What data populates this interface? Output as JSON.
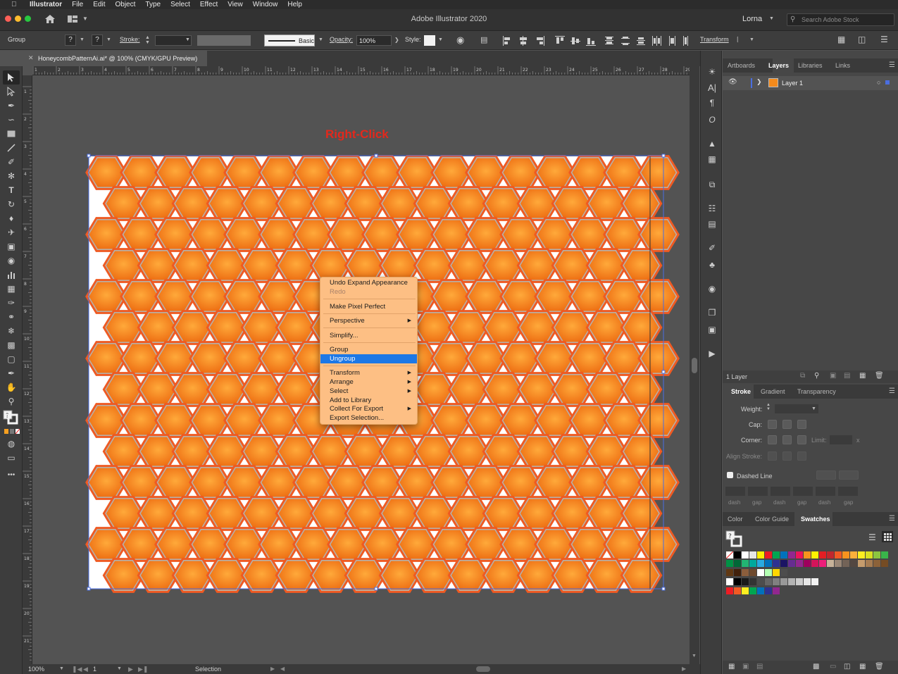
{
  "menubar": {
    "app_name": "Illustrator",
    "items": [
      "File",
      "Edit",
      "Object",
      "Type",
      "Select",
      "Effect",
      "View",
      "Window",
      "Help"
    ]
  },
  "appbar": {
    "title": "Adobe Illustrator 2020",
    "user": "Lorna",
    "search_placeholder": "Search Adobe Stock"
  },
  "control_bar": {
    "selection_type": "Group",
    "stroke_label": "Stroke:",
    "brush_name": "Basic",
    "opacity_label": "Opacity:",
    "opacity_value": "100%",
    "style_label": "Style:",
    "transform_label": "Transform"
  },
  "document": {
    "tab_title": "HoneycombPatternAi.ai* @ 100% (CMYK/GPU Preview)",
    "ruler_top_labels": [
      "1",
      "2",
      "3",
      "4",
      "5",
      "6",
      "7",
      "8",
      "9",
      "10",
      "11",
      "12",
      "13",
      "14",
      "15",
      "16",
      "17",
      "18",
      "19",
      "20",
      "21",
      "22",
      "23",
      "24",
      "25",
      "26",
      "27",
      "28",
      "29"
    ],
    "ruler_left_labels": [
      "1",
      "2",
      "3",
      "4",
      "5",
      "6",
      "7",
      "8",
      "9",
      "10",
      "11",
      "12",
      "13",
      "14",
      "15",
      "16",
      "17",
      "18",
      "19",
      "20",
      "21"
    ]
  },
  "annotation": "Right-Click",
  "context_menu": {
    "items": [
      {
        "label": "Undo Expand Appearance",
        "disabled": false,
        "submenu": false
      },
      {
        "label": "Redo",
        "disabled": true,
        "submenu": false
      },
      {
        "label": "Make Pixel Perfect",
        "disabled": false,
        "submenu": false
      },
      {
        "label": "Perspective",
        "disabled": false,
        "submenu": true
      },
      {
        "label": "Simplify...",
        "disabled": false,
        "submenu": false
      },
      {
        "label": "Group",
        "disabled": false,
        "submenu": false
      },
      {
        "label": "Ungroup",
        "disabled": false,
        "submenu": false,
        "highlighted": true
      },
      {
        "label": "Transform",
        "disabled": false,
        "submenu": true
      },
      {
        "label": "Arrange",
        "disabled": false,
        "submenu": true
      },
      {
        "label": "Select",
        "disabled": false,
        "submenu": true
      },
      {
        "label": "Add to Library",
        "disabled": false,
        "submenu": false
      },
      {
        "label": "Collect For Export",
        "disabled": false,
        "submenu": true
      },
      {
        "label": "Export Selection...",
        "disabled": false,
        "submenu": false
      }
    ]
  },
  "status_bar": {
    "zoom": "100%",
    "artboard_number": "1",
    "tool": "Selection"
  },
  "layers_panel": {
    "tabs": [
      "Artboards",
      "Layers",
      "Libraries",
      "Links"
    ],
    "active_tab": "Layers",
    "layer_name": "Layer 1",
    "footer_count": "1 Layer"
  },
  "stroke_panel": {
    "tabs": [
      "Stroke",
      "Gradient",
      "Transparency"
    ],
    "active_tab": "Stroke",
    "weight_label": "Weight:",
    "cap_label": "Cap:",
    "corner_label": "Corner:",
    "limit_label": "Limit:",
    "limit_unit": "x",
    "align_label": "Align Stroke:",
    "dashed_label": "Dashed Line",
    "dash_labels": [
      "dash",
      "gap",
      "dash",
      "gap",
      "dash",
      "gap"
    ]
  },
  "swatches_panel": {
    "tabs": [
      "Color",
      "Color Guide",
      "Swatches"
    ],
    "active_tab": "Swatches",
    "row1": [
      "#ffffff",
      "#000000",
      "#ffffff",
      "#e6e6e6",
      "#ffef00",
      "#ed1c24",
      "#00a651",
      "#0072bc",
      "#92278f",
      "#ed145b",
      "#f7941d",
      "#fff200",
      "#e31e24",
      "#c1272d",
      "#f15a24",
      "#f7931e",
      "#fbb03b",
      "#fcee21",
      "#d9e021",
      "#8cc63f",
      "#39b54a"
    ],
    "row2": [
      "#009245",
      "#006837",
      "#22b573",
      "#00a99d",
      "#29abe2",
      "#0071bc",
      "#2e3192",
      "#1b1464",
      "#662d91",
      "#93278f",
      "#9e005d",
      "#d4145a",
      "#ed1e79",
      "#c7b299",
      "#998675",
      "#736357",
      "#534741",
      "#c69c6d",
      "#a67c52",
      "#8c6239",
      "#754c24"
    ],
    "row3": [
      "#603813",
      "#42210b",
      "#8b5e3c",
      "#6e4a2e",
      "#ffffff",
      "#b3ffb3",
      "#ffd700",
      "#4d4d4d"
    ],
    "row4": [
      "#ffffff",
      "#000000",
      "#1a1a1a",
      "#333333",
      "#4d4d4d",
      "#666666",
      "#808080",
      "#999999",
      "#b3b3b3",
      "#cccccc",
      "#e6e6e6",
      "#f2f2f2"
    ],
    "row5": [
      "#ed1c24",
      "#f15a24",
      "#fcee21",
      "#00a651",
      "#0071bc",
      "#2e3192",
      "#92278f"
    ]
  },
  "colors": {
    "hex_fill_light": "#ffa93a",
    "hex_fill_dark": "#ec6a10",
    "hex_stroke_inner": "#b7b0a8",
    "hex_stroke_outer": "#ef5a22",
    "selection_blue": "#4a6ee0",
    "menu_bg": "#fdbf84",
    "menu_highlight": "#1d78e6",
    "arrow_red": "#e4281c"
  }
}
